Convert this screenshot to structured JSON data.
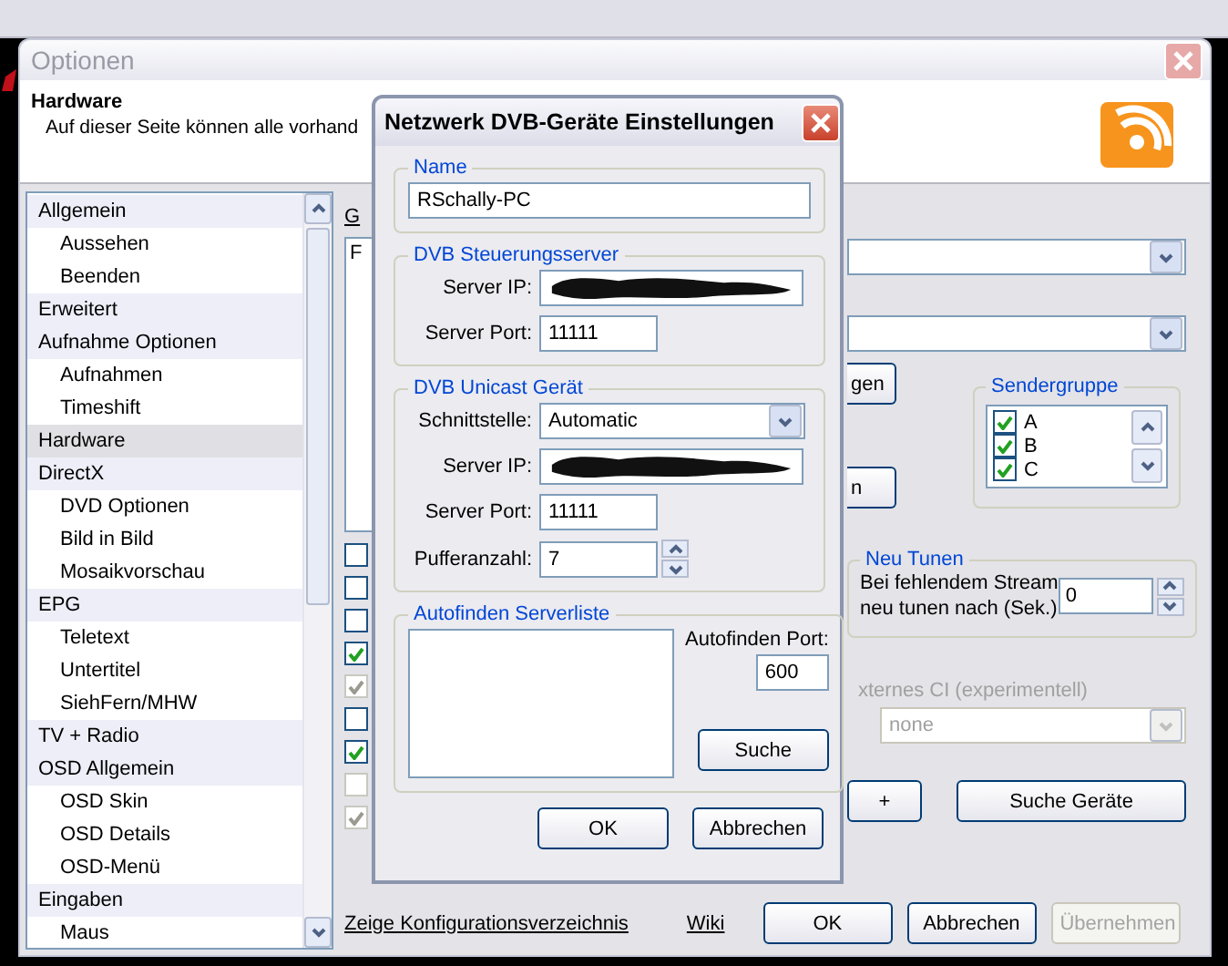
{
  "options_window": {
    "title": "Optionen",
    "header": {
      "title": "Hardware",
      "description": "Auf dieser Seite können alle vorhand"
    },
    "tree": [
      {
        "label": "Allgemein",
        "selected": false,
        "children": [
          {
            "label": "Aussehen",
            "selected": false
          },
          {
            "label": "Beenden",
            "selected": false
          }
        ]
      },
      {
        "label": "Erweitert",
        "selected": false
      },
      {
        "label": "Aufnahme Optionen",
        "selected": false,
        "children": [
          {
            "label": "Aufnahmen",
            "selected": false
          },
          {
            "label": "Timeshift",
            "selected": false
          }
        ]
      },
      {
        "label": "Hardware",
        "selected": true
      },
      {
        "label": "DirectX",
        "selected": false,
        "children": [
          {
            "label": "DVD Optionen",
            "selected": false
          },
          {
            "label": "Bild in Bild",
            "selected": false
          },
          {
            "label": "Mosaikvorschau",
            "selected": false
          }
        ]
      },
      {
        "label": "EPG",
        "selected": false,
        "children": [
          {
            "label": "Teletext",
            "selected": false
          },
          {
            "label": "Untertitel",
            "selected": false
          },
          {
            "label": "SiehFern/MHW",
            "selected": false
          }
        ]
      },
      {
        "label": "TV + Radio",
        "selected": false
      },
      {
        "label": "OSD Allgemein",
        "selected": false,
        "children": [
          {
            "label": "OSD Skin",
            "selected": false
          },
          {
            "label": "OSD Details",
            "selected": false
          },
          {
            "label": "OSD-Menü",
            "selected": false
          }
        ]
      },
      {
        "label": "Eingaben",
        "selected": false,
        "children": [
          {
            "label": "Maus",
            "selected": false
          }
        ]
      }
    ],
    "panel": {
      "section_label": "G",
      "list_item": "F",
      "checkboxes": [
        {
          "checked": false,
          "disabled": false
        },
        {
          "checked": false,
          "disabled": false
        },
        {
          "checked": false,
          "disabled": false
        },
        {
          "checked": true,
          "disabled": false
        },
        {
          "checked": true,
          "disabled": true
        },
        {
          "checked": false,
          "disabled": false
        },
        {
          "checked": true,
          "disabled": false
        },
        {
          "checked": false,
          "disabled": true
        },
        {
          "checked": true,
          "disabled": true
        }
      ],
      "partial_buttons": [
        "gen",
        "n"
      ],
      "sendergruppe": {
        "title": "Sendergruppe",
        "items": [
          {
            "label": "A",
            "checked": true
          },
          {
            "label": "B",
            "checked": true
          },
          {
            "label": "C",
            "checked": true
          }
        ]
      },
      "neu_tunen": {
        "title": "Neu Tunen",
        "label_lines": [
          "Bei fehlendem Stream",
          "neu tunen nach (Sek.)"
        ],
        "value": "0"
      },
      "ci": {
        "label": "xternes CI (experimentell)",
        "value": "none",
        "disabled": true
      },
      "buttons": [
        {
          "label": "+"
        },
        {
          "label": "Suche Geräte"
        }
      ]
    },
    "footer": {
      "links": [
        "Zeige Konfigurationsverzeichnis",
        "Wiki"
      ],
      "buttons": [
        {
          "label": "OK",
          "disabled": false
        },
        {
          "label": "Abbrechen",
          "disabled": false
        },
        {
          "label": "Übernehmen",
          "disabled": true
        }
      ]
    }
  },
  "dialog": {
    "title": "Netzwerk DVB-Geräte Einstellungen",
    "name_group": {
      "title": "Name",
      "value": "RSchally-PC"
    },
    "groups": [
      {
        "title": "DVB Steuerungsserver",
        "fields": [
          {
            "kind": "redacted",
            "label": "Server IP:"
          },
          {
            "kind": "text",
            "label": "Server Port:",
            "value": "11111"
          }
        ]
      },
      {
        "title": "DVB Unicast Gerät",
        "fields": [
          {
            "kind": "combo",
            "label": "Schnittstelle:",
            "value": "Automatic"
          },
          {
            "kind": "redacted",
            "label": "Server IP:"
          },
          {
            "kind": "text",
            "label": "Server Port:",
            "value": "11111"
          },
          {
            "kind": "spin",
            "label": "Pufferanzahl:",
            "value": "7"
          }
        ]
      }
    ],
    "autofind": {
      "title": "Autofinden Serverliste",
      "port_label": "Autofinden Port:",
      "port": "600",
      "button": "Suche"
    },
    "buttons": [
      {
        "label": "OK"
      },
      {
        "label": "Abbrechen"
      }
    ]
  }
}
